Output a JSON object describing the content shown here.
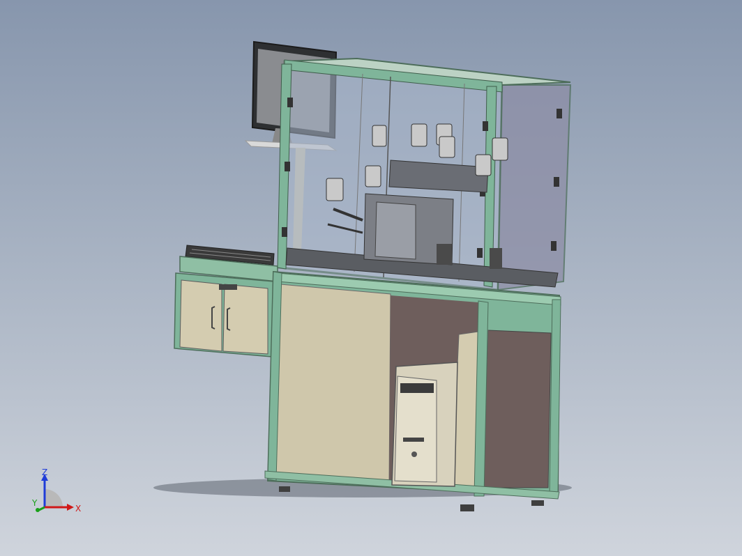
{
  "view": {
    "background_top": "#8796ad",
    "background_bottom": "#cfd4dc",
    "frame_color": "#7fb59a",
    "panel_color": "#cfc7ab",
    "dark_panel_color": "#6e5e5c",
    "glass_color": "#b7c3d6"
  },
  "triad": {
    "z_label": "Z",
    "x_label": "X",
    "y_label": "Y",
    "z_color": "#1f3cd8",
    "x_color": "#d01818",
    "y_color": "#19a019"
  }
}
